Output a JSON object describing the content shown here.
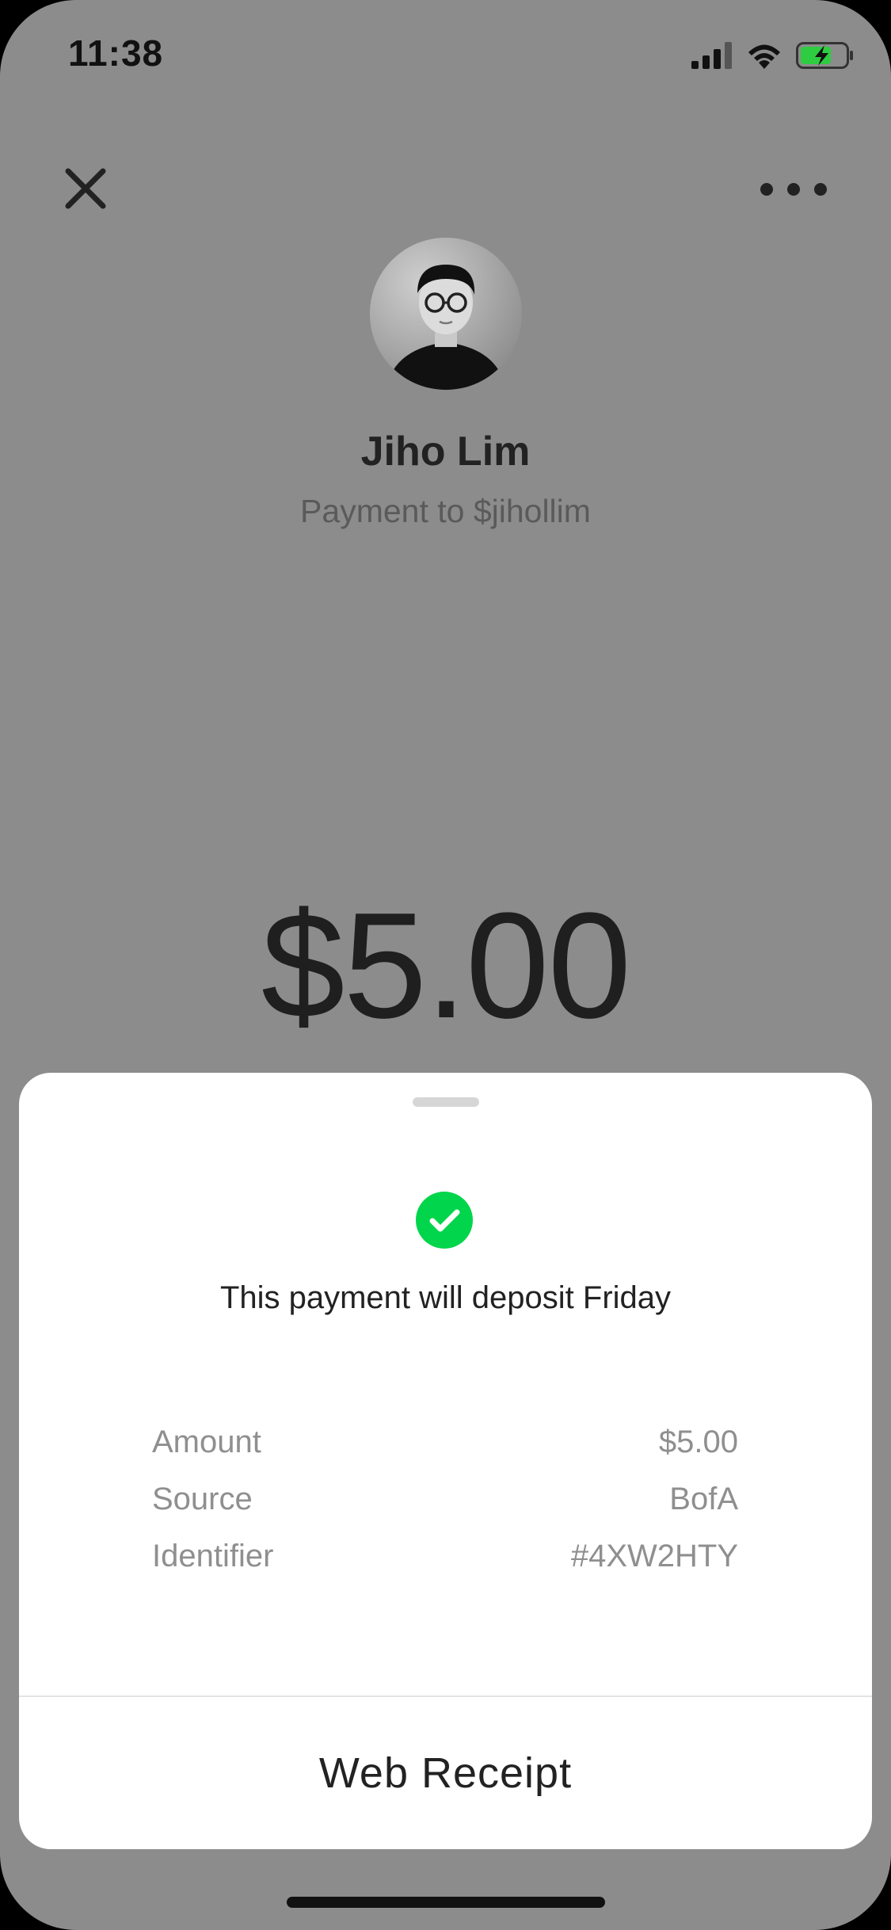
{
  "status_bar": {
    "time": "11:38"
  },
  "nav": {
    "close_icon": "close-icon",
    "more_icon": "more-horizontal-icon"
  },
  "profile": {
    "name": "Jiho Lim",
    "subtitle": "Payment to $jihollim"
  },
  "payment": {
    "amount": "$5.00"
  },
  "sheet": {
    "status_icon": "check-circle-icon",
    "status_color": "#00d54b",
    "message": "This payment will deposit Friday",
    "details": [
      {
        "label": "Amount",
        "value": "$5.00"
      },
      {
        "label": "Source",
        "value": "BofA"
      },
      {
        "label": "Identifier",
        "value": "#4XW2HTY"
      }
    ],
    "receipt_button": "Web Receipt"
  }
}
